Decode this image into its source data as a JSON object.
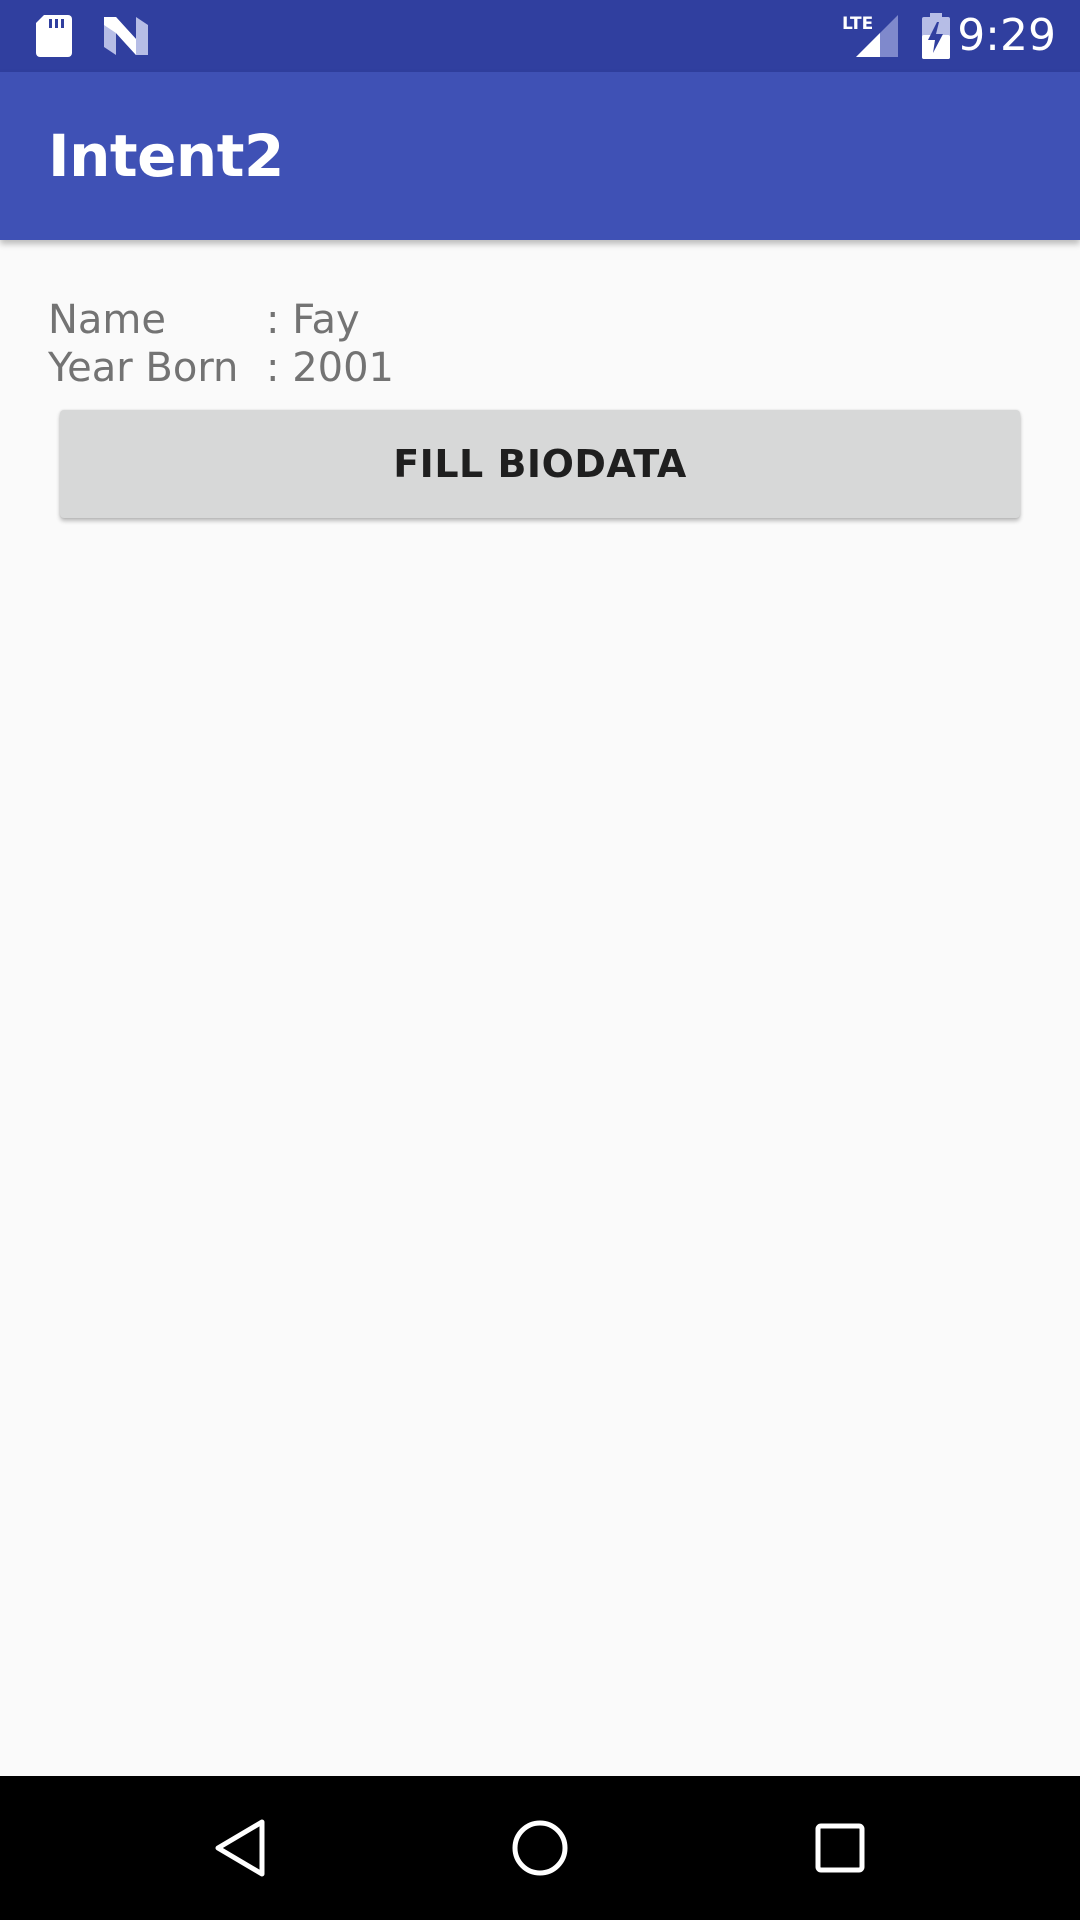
{
  "status_bar": {
    "time": "9:29",
    "network_label": "LTE",
    "icons": [
      "sd-card-icon",
      "n-notification-icon",
      "lte-signal-icon",
      "battery-charging-icon"
    ],
    "background": "#303f9f"
  },
  "app_bar": {
    "title": "Intent2",
    "background": "#3f51b5"
  },
  "biodata": {
    "name_label": "Name",
    "name_value": ": Fay",
    "year_label": "Year Born",
    "year_value": ": 2001"
  },
  "fill_button": {
    "label": "FILL BIODATA"
  },
  "nav_bar": {
    "icons": [
      "back-icon",
      "home-icon",
      "recents-icon"
    ]
  }
}
